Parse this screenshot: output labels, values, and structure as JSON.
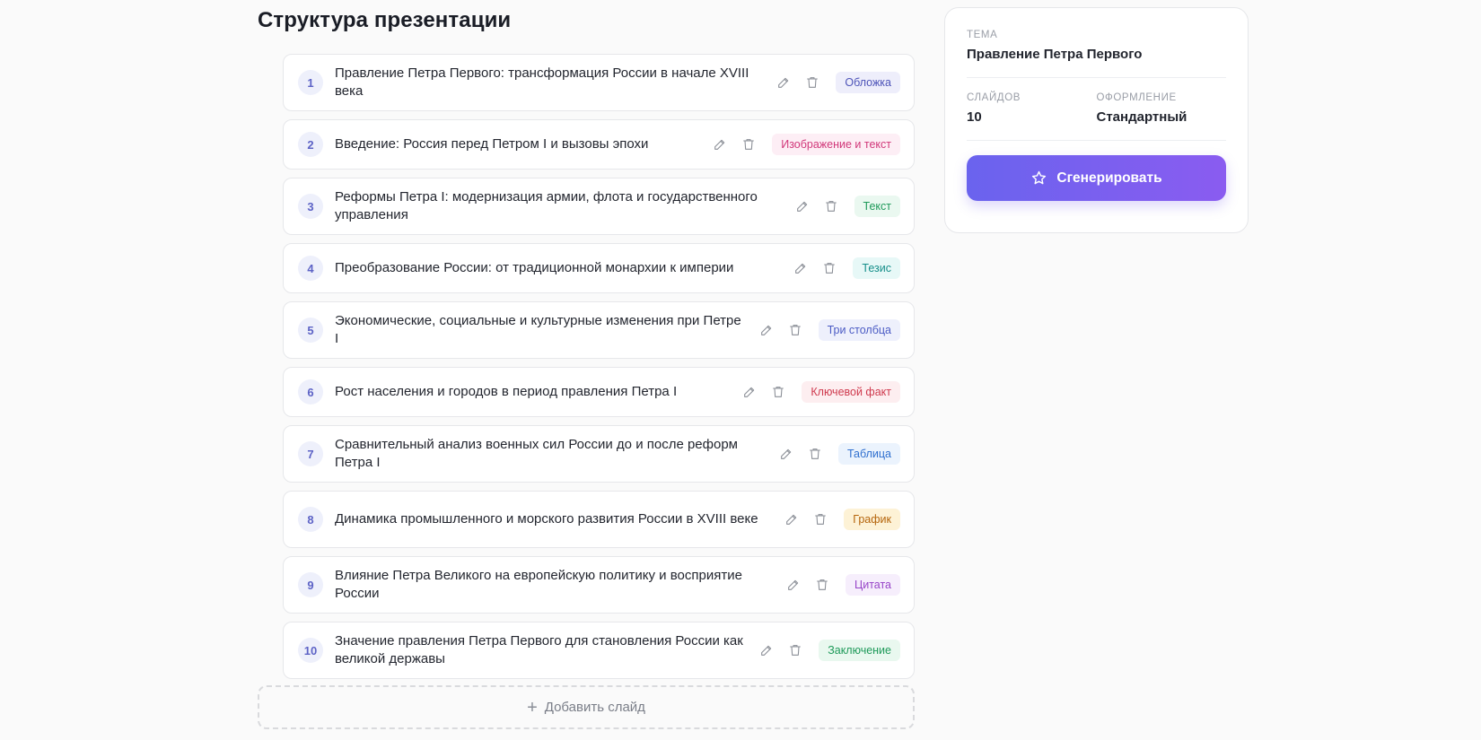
{
  "page": {
    "title": "Структура презентации",
    "add_slide_label": "Добавить слайд",
    "add_slide_icon": "plus-icon"
  },
  "slides": [
    {
      "number": "1",
      "title": "Правление Петра Первого: трансформация России в начале XVIII века",
      "layout": "Обложка",
      "badge_bg": "#eeeefb",
      "badge_fg": "#4d53b8"
    },
    {
      "number": "2",
      "title": "Введение: Россия перед Петром I и вызовы эпохи",
      "layout": "Изображение и текст",
      "badge_bg": "#fdeef5",
      "badge_fg": "#d1387a"
    },
    {
      "number": "3",
      "title": "Реформы Петра I: модернизация армии, флота и государственного управления",
      "layout": "Текст",
      "badge_bg": "#eaf8f0",
      "badge_fg": "#1f9a5a"
    },
    {
      "number": "4",
      "title": "Преобразование России: от традиционной монархии к империи",
      "layout": "Тезис",
      "badge_bg": "#e7f8f7",
      "badge_fg": "#168f8a"
    },
    {
      "number": "5",
      "title": "Экономические, социальные и культурные изменения при Петре I",
      "layout": "Три столбца",
      "badge_bg": "#eef0fc",
      "badge_fg": "#4b5bc4"
    },
    {
      "number": "6",
      "title": "Рост населения и городов в период правления Петра I",
      "layout": "Ключевой факт",
      "badge_bg": "#fdeef0",
      "badge_fg": "#cf3a4e"
    },
    {
      "number": "7",
      "title": "Сравнительный анализ военных сил России до и после реформ Петра I",
      "layout": "Таблица",
      "badge_bg": "#ebf3fd",
      "badge_fg": "#2f6fcf"
    },
    {
      "number": "8",
      "title": "Динамика промышленного и морского развития России в XVIII веке",
      "layout": "График",
      "badge_bg": "#fdf2d6",
      "badge_fg": "#b5650c"
    },
    {
      "number": "9",
      "title": "Влияние Петра Великого на европейскую политику и восприятие России",
      "layout": "Цитата",
      "badge_bg": "#f6eefc",
      "badge_fg": "#9745c8"
    },
    {
      "number": "10",
      "title": "Значение правления Петра Первого для становления России как великой державы",
      "layout": "Заключение",
      "badge_bg": "#e9f8ef",
      "badge_fg": "#1f9a5a"
    }
  ],
  "panel": {
    "topic_label": "Тема",
    "topic_value": "Правление Петра Первого",
    "slides_label": "Слайдов",
    "slides_value": "10",
    "design_label": "Оформление",
    "design_value": "Стандартный",
    "generate_label": "Сгенерировать",
    "generate_icon": "star-icon"
  },
  "colors": {
    "accent_start": "#6a63ee",
    "accent_end": "#8a5cf0",
    "number_bg": "#eef0fb",
    "number_fg": "#5d63c6"
  },
  "icons": {
    "edit": "pencil-icon",
    "delete": "trash-icon"
  }
}
